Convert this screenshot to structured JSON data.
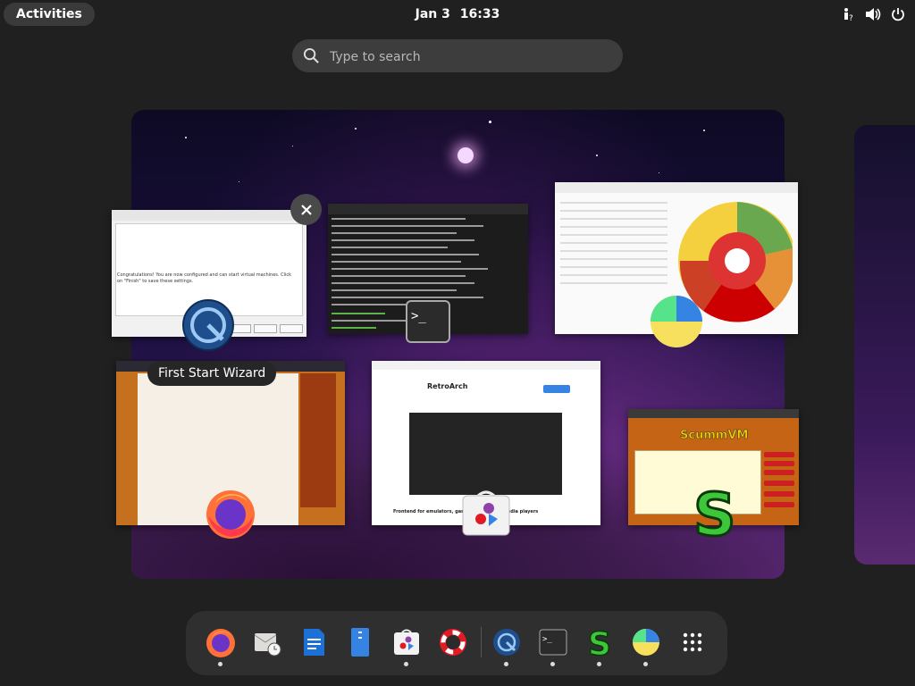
{
  "topbar": {
    "activities_label": "Activities",
    "date": "Jan 3",
    "time": "16:33",
    "tray_icons": [
      "accessibility-icon",
      "volume-icon",
      "power-icon"
    ]
  },
  "search": {
    "placeholder": "Type to search"
  },
  "windows": [
    {
      "app": "First Start Wizard",
      "icon": "virt-manager-icon"
    },
    {
      "app": "Terminal",
      "icon": "terminal-icon"
    },
    {
      "app": "Disk Usage Analyzer",
      "icon": "baobab-icon"
    },
    {
      "app": "Firefox",
      "icon": "firefox-icon"
    },
    {
      "app": "Software",
      "icon": "software-icon",
      "content_title": "RetroArch",
      "content_heading": "Frontend for emulators, game engines and media players"
    },
    {
      "app": "ScummVM",
      "icon": "scummvm-icon",
      "content_logo": "ScummVM"
    }
  ],
  "wizard": {
    "message": "Congratulations! You are now configured and can start virtual machines. Click on \"Finish\" to save these settings."
  },
  "tooltip": {
    "label": "First Start Wizard"
  },
  "dash": {
    "items": [
      {
        "name": "Firefox",
        "icon": "firefox-icon",
        "running": true
      },
      {
        "name": "Evolution",
        "icon": "mail-clock-icon",
        "running": false
      },
      {
        "name": "Writer",
        "icon": "writer-icon",
        "running": false
      },
      {
        "name": "Files",
        "icon": "files-icon",
        "running": false
      },
      {
        "name": "Software",
        "icon": "software-icon",
        "running": true
      },
      {
        "name": "Help",
        "icon": "help-icon",
        "running": false
      },
      {
        "name": "Virtual Machine Manager",
        "icon": "virt-manager-icon",
        "running": true
      },
      {
        "name": "Terminal",
        "icon": "terminal-icon",
        "running": true
      },
      {
        "name": "ScummVM",
        "icon": "scummvm-icon",
        "running": true
      },
      {
        "name": "Disk Usage Analyzer",
        "icon": "baobab-icon",
        "running": true
      },
      {
        "name": "Show Apps",
        "icon": "app-grid-icon",
        "running": false
      }
    ]
  },
  "colors": {
    "panel": "#202020",
    "accent": "#3584e4",
    "dash_bg": "#2f2f2f"
  }
}
